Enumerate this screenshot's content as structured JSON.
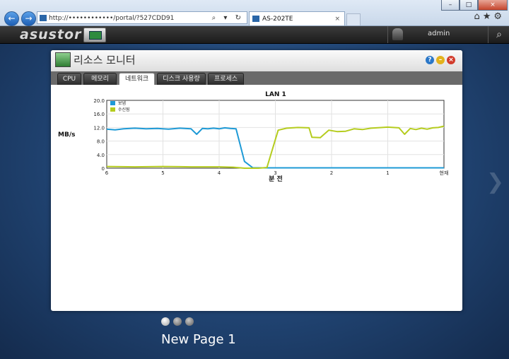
{
  "browser": {
    "address": "http://••••••••••••/portal/?527CDD91",
    "tab_title": "AS-202TE",
    "tab_close": "×",
    "address_icons": "⌕ ▾ ↻",
    "tools": "⌂★⚙",
    "back_glyph": "←",
    "forward_glyph": "→",
    "window_controls": [
      "–",
      "□",
      "×"
    ]
  },
  "app": {
    "logo": "asustor",
    "user": "admin",
    "search_glyph": "⌕",
    "next_glyph": "❯"
  },
  "window": {
    "title": "리소스 모니터",
    "help": "?",
    "minimize": "–",
    "close": "×",
    "tabs": [
      "CPU",
      "메모리",
      "네트워크",
      "디스크 사용량",
      "프로세스"
    ],
    "active_tab": 2
  },
  "chart_data": {
    "type": "line",
    "title": "LAN 1",
    "xlabel": "분 전",
    "ylabel": "MB/s",
    "ylim": [
      0,
      20
    ],
    "yticks": [
      "0",
      "4.0",
      "8.0",
      "12.0",
      "16.0",
      "20.0"
    ],
    "xlim": [
      6,
      0
    ],
    "xticks": [
      "6",
      "5",
      "4",
      "3",
      "2",
      "1",
      "현재"
    ],
    "grid": true,
    "legend": "top-left",
    "series": [
      {
        "name": "보냄",
        "color": "#1e9ad6",
        "x": [
          6,
          5.85,
          5.7,
          5.5,
          5.3,
          5.1,
          4.9,
          4.7,
          4.5,
          4.4,
          4.3,
          4.2,
          4.1,
          4.0,
          3.9,
          3.8,
          3.7,
          3.55,
          3.4,
          3.2,
          3.0,
          2.8,
          2.5,
          2.0,
          1.5,
          1.0,
          0.5,
          0
        ],
        "values": [
          11.5,
          11.3,
          11.6,
          11.8,
          11.6,
          11.7,
          11.5,
          11.8,
          11.6,
          10.0,
          11.7,
          11.6,
          11.8,
          11.6,
          11.9,
          11.7,
          11.6,
          2.0,
          0.1,
          0.1,
          0.1,
          0.1,
          0.1,
          0.1,
          0.1,
          0.1,
          0.1,
          0.1
        ]
      },
      {
        "name": "수신됨",
        "color": "#b5cc1e",
        "x": [
          6,
          5.5,
          5.0,
          4.5,
          4.0,
          3.75,
          3.55,
          3.3,
          3.15,
          2.95,
          2.8,
          2.6,
          2.4,
          2.35,
          2.2,
          2.05,
          1.9,
          1.75,
          1.6,
          1.45,
          1.3,
          1.1,
          1.0,
          0.9,
          0.8,
          0.7,
          0.6,
          0.5,
          0.4,
          0.3,
          0.2,
          0.1,
          0
        ],
        "values": [
          0.5,
          0.4,
          0.5,
          0.4,
          0.4,
          0.3,
          0.0,
          0.0,
          0.2,
          11.2,
          11.8,
          12.0,
          11.9,
          9.1,
          9.0,
          11.2,
          10.8,
          10.9,
          11.6,
          11.4,
          11.8,
          12.0,
          12.1,
          12.0,
          11.9,
          10.0,
          11.7,
          11.4,
          11.8,
          11.5,
          11.9,
          12.0,
          12.4
        ]
      }
    ]
  },
  "footer": {
    "pages": 3,
    "active_page": 0,
    "page_label": "New Page 1"
  }
}
